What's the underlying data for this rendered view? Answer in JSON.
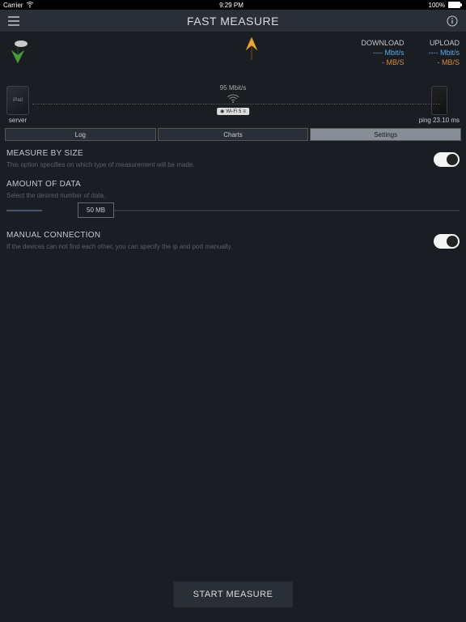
{
  "status_bar": {
    "carrier": "Carrier",
    "time": "9:29 PM",
    "battery": "100%"
  },
  "nav": {
    "title": "FAST MEASURE"
  },
  "speeds": {
    "download": {
      "label": "DOWNLOAD",
      "mbit": "---- Mbit/s",
      "mbs": "- MB/S"
    },
    "upload": {
      "label": "UPLOAD",
      "mbit": "---- Mbit/s",
      "mbs": "- MB/S"
    }
  },
  "devices": {
    "left_label": "server",
    "wifi_speed": "95 Mbit/s",
    "wifi_badge": "Wi-Fi 5",
    "ping": "ping 23.10 ms"
  },
  "tabs": {
    "log": "Log",
    "charts": "Charts",
    "settings": "Settings"
  },
  "settings": {
    "measure_by_size": {
      "title": "MEASURE BY SIZE",
      "desc": "This option specifies on which type of measurement will be made."
    },
    "amount_of_data": {
      "title": "AMOUNT OF DATA",
      "desc": "Select the desired number of data.",
      "value": "50 MB"
    },
    "manual_connection": {
      "title": "MANUAL CONNECTION",
      "desc": "If the devices can not find each other, you can specify the ip and port manually."
    }
  },
  "start_button": "START MEASURE"
}
